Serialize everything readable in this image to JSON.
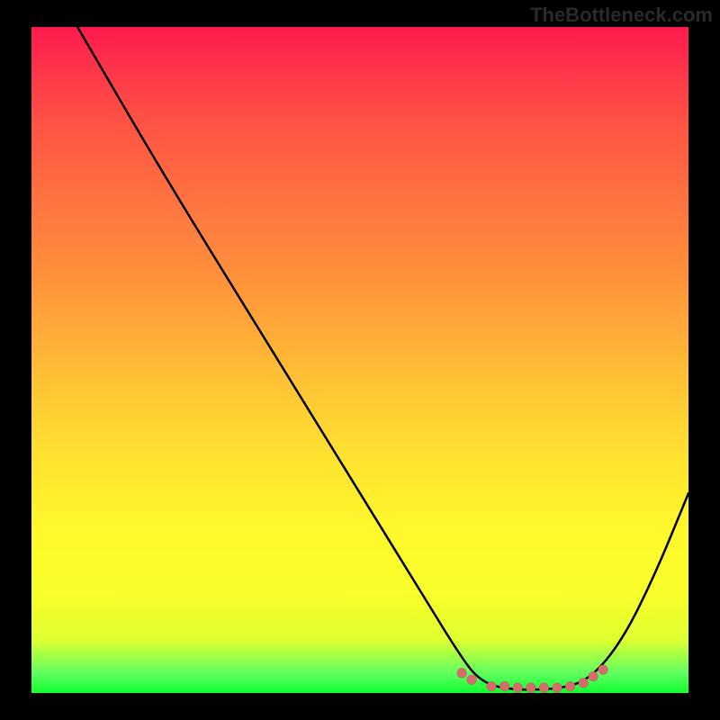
{
  "watermark": "TheBottleneck.com",
  "chart_data": {
    "type": "line",
    "title": "",
    "xlabel": "",
    "ylabel": "",
    "xlim": [
      0,
      100
    ],
    "ylim": [
      0,
      100
    ],
    "curve": [
      {
        "x": 7,
        "y": 100
      },
      {
        "x": 20,
        "y": 78
      },
      {
        "x": 35,
        "y": 54
      },
      {
        "x": 50,
        "y": 30
      },
      {
        "x": 60,
        "y": 14
      },
      {
        "x": 65,
        "y": 6
      },
      {
        "x": 68,
        "y": 2
      },
      {
        "x": 72,
        "y": 0.5
      },
      {
        "x": 80,
        "y": 0.5
      },
      {
        "x": 85,
        "y": 2
      },
      {
        "x": 90,
        "y": 8
      },
      {
        "x": 95,
        "y": 18
      },
      {
        "x": 100,
        "y": 30
      }
    ],
    "minimum_band": {
      "x_start": 67,
      "x_end": 86,
      "y": 0.5
    },
    "dots": [
      {
        "x": 65.5,
        "y": 3
      },
      {
        "x": 67,
        "y": 2
      },
      {
        "x": 70,
        "y": 1
      },
      {
        "x": 72,
        "y": 1
      },
      {
        "x": 74,
        "y": 0.8
      },
      {
        "x": 76,
        "y": 0.8
      },
      {
        "x": 78,
        "y": 0.8
      },
      {
        "x": 80,
        "y": 0.8
      },
      {
        "x": 82,
        "y": 1
      },
      {
        "x": 84,
        "y": 1.5
      },
      {
        "x": 85.5,
        "y": 2.5
      },
      {
        "x": 87,
        "y": 3.5
      }
    ],
    "gradient_stops": [
      {
        "pos": 0,
        "color": "#ff1a4d"
      },
      {
        "pos": 50,
        "color": "#ffcc33"
      },
      {
        "pos": 90,
        "color": "#f0ff2c"
      },
      {
        "pos": 100,
        "color": "#10ff30"
      }
    ]
  }
}
